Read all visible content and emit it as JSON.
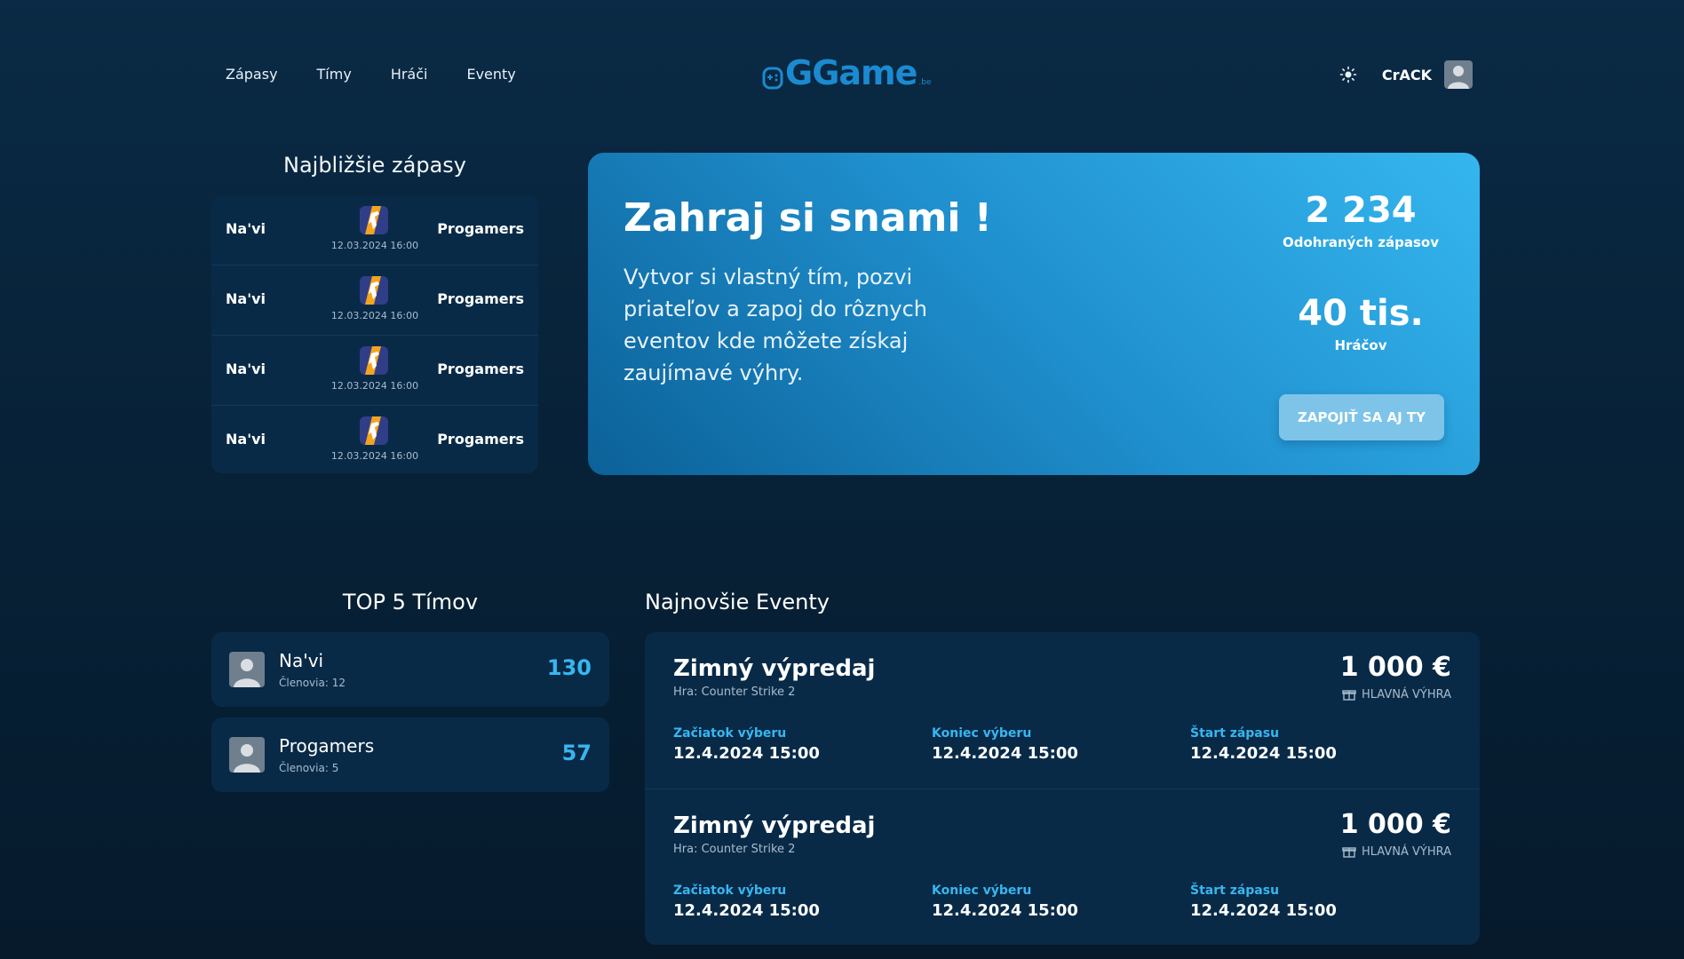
{
  "nav": {
    "items": [
      "Zápasy",
      "Tímy",
      "Hráči",
      "Eventy"
    ]
  },
  "logo": {
    "text": "GGame",
    "sub": ".be"
  },
  "user": {
    "name": "CrACK"
  },
  "matches": {
    "title": "Najbližšie zápasy",
    "items": [
      {
        "team1": "Na'vi",
        "team2": "Progamers",
        "date": "12.03.2024 16:00"
      },
      {
        "team1": "Na'vi",
        "team2": "Progamers",
        "date": "12.03.2024 16:00"
      },
      {
        "team1": "Na'vi",
        "team2": "Progamers",
        "date": "12.03.2024 16:00"
      },
      {
        "team1": "Na'vi",
        "team2": "Progamers",
        "date": "12.03.2024 16:00"
      }
    ]
  },
  "hero": {
    "title": "Zahraj si snami !",
    "description": "Vytvor si vlastný tím, pozvi priateľov a zapoj do rôznych eventov kde môžete získaj zaujímavé výhry.",
    "stats": [
      {
        "value": "2 234",
        "label": "Odohraných zápasov"
      },
      {
        "value": "40 tis.",
        "label": "Hráčov"
      }
    ],
    "cta": "ZAPOJIŤ SA AJ TY"
  },
  "top_teams": {
    "title": "TOP 5 Tímov",
    "items": [
      {
        "name": "Na'vi",
        "members": "Členovia: 12",
        "score": "130"
      },
      {
        "name": "Progamers",
        "members": "Členovia: 5",
        "score": "57"
      }
    ]
  },
  "events": {
    "title": "Najnovšie Eventy",
    "items": [
      {
        "name": "Zimný výpredaj",
        "game": "Hra: Counter Strike 2",
        "prize": "1 000 €",
        "prize_label": "HLAVNÁ VÝHRA",
        "cols": [
          {
            "label": "Začiatok výberu",
            "value": "12.4.2024 15:00"
          },
          {
            "label": "Koniec výberu",
            "value": "12.4.2024 15:00"
          },
          {
            "label": "Štart zápasu",
            "value": "12.4.2024 15:00"
          }
        ]
      },
      {
        "name": "Zimný výpredaj",
        "game": "Hra: Counter Strike 2",
        "prize": "1 000 €",
        "prize_label": "HLAVNÁ VÝHRA",
        "cols": [
          {
            "label": "Začiatok výberu",
            "value": "12.4.2024 15:00"
          },
          {
            "label": "Koniec výberu",
            "value": "12.4.2024 15:00"
          },
          {
            "label": "Štart zápasu",
            "value": "12.4.2024 15:00"
          }
        ]
      }
    ]
  }
}
